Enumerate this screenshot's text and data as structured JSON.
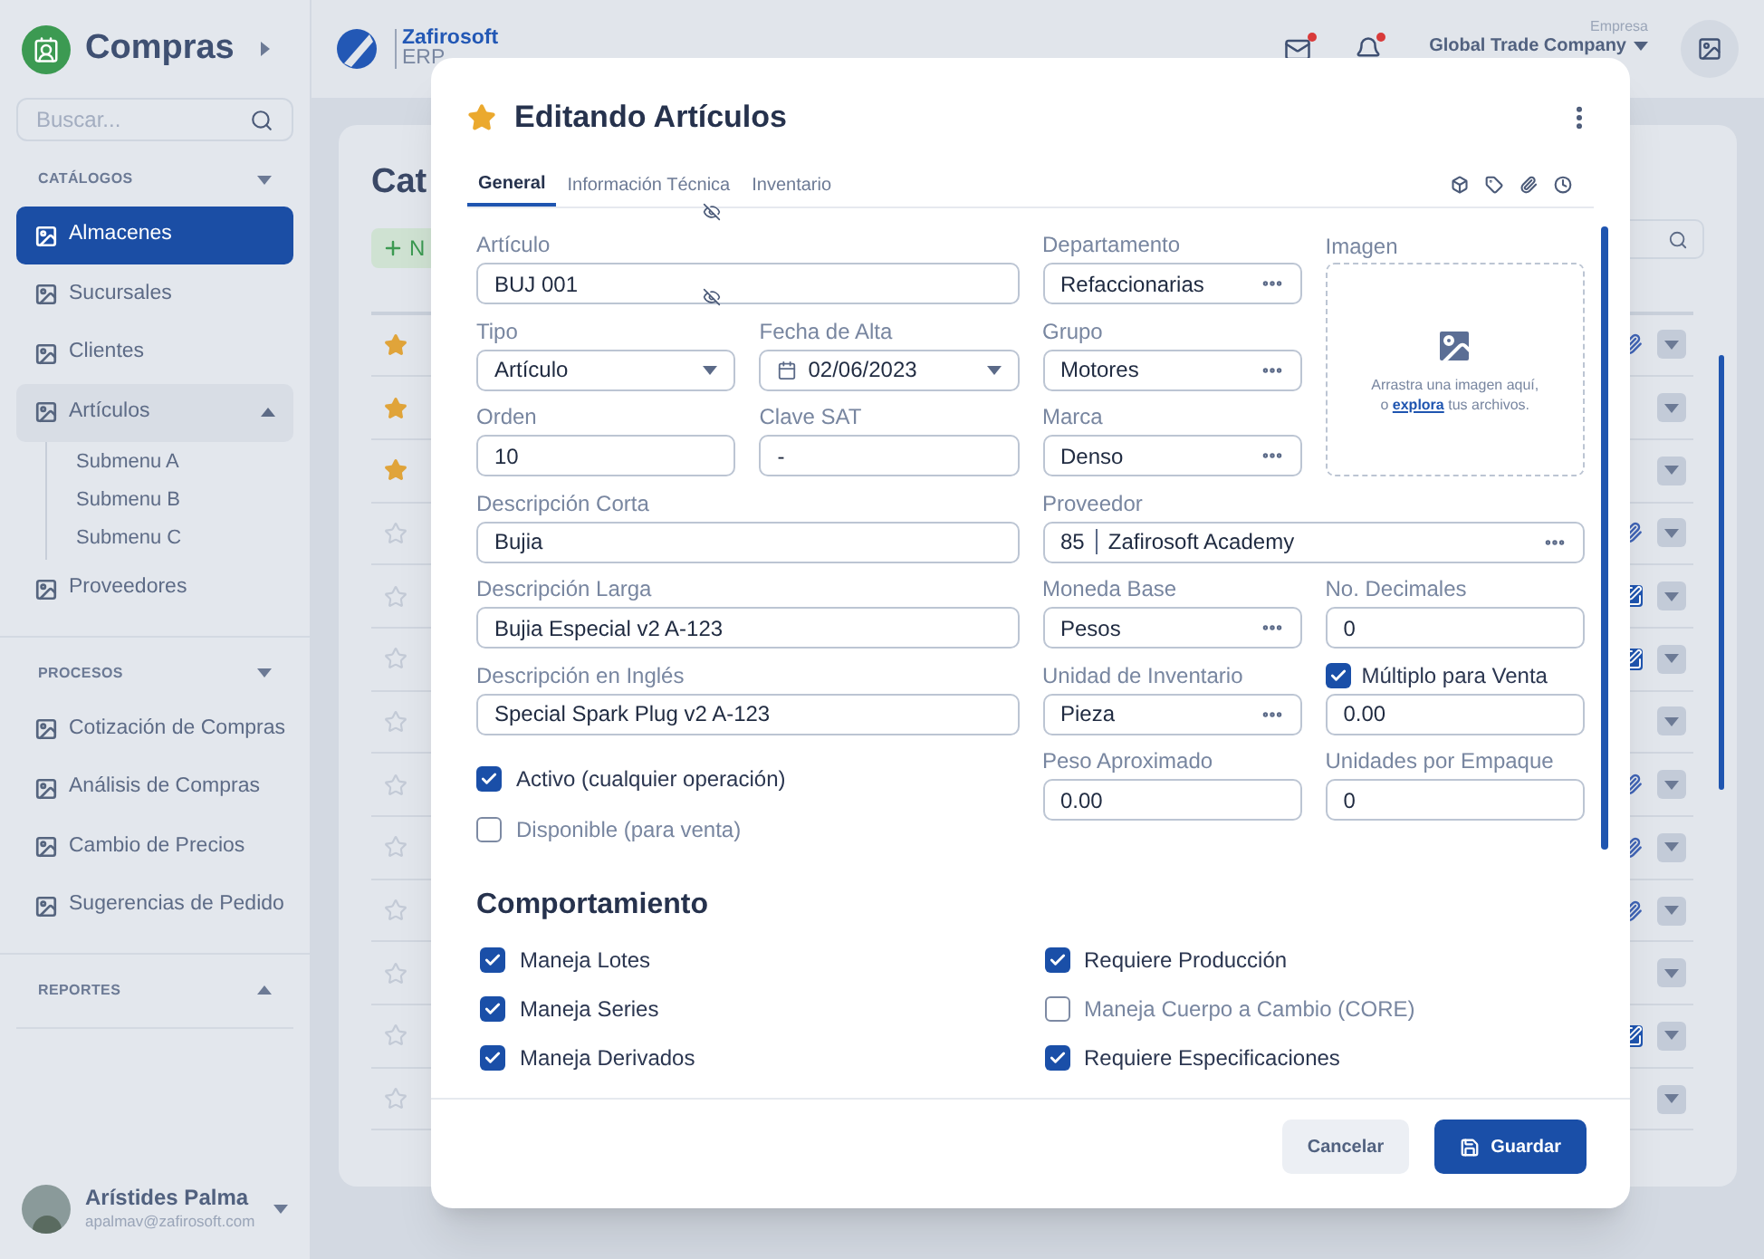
{
  "sidebar": {
    "module_title": "Compras",
    "search": {
      "placeholder": "Buscar..."
    },
    "sections": [
      {
        "title": "CATÁLOGOS",
        "expanded": true,
        "items": [
          {
            "label": "Almacenes",
            "selected": true
          },
          {
            "label": "Sucursales",
            "selected": false
          },
          {
            "label": "Clientes",
            "selected": false
          },
          {
            "label": "Artículos",
            "selected": false,
            "expanded": true,
            "children": [
              {
                "label": "Submenu A"
              },
              {
                "label": "Submenu B"
              },
              {
                "label": "Submenu C"
              }
            ]
          },
          {
            "label": "Proveedores",
            "selected": false
          }
        ]
      },
      {
        "title": "PROCESOS",
        "expanded": true,
        "items": [
          {
            "label": "Cotización de Compras",
            "selected": false
          },
          {
            "label": "Análisis de Compras",
            "selected": false
          },
          {
            "label": "Cambio de Precios",
            "selected": false
          },
          {
            "label": "Sugerencias de Pedido",
            "selected": false
          }
        ]
      },
      {
        "title": "REPORTES",
        "expanded": false
      }
    ],
    "user": {
      "name": "Arístides Palma",
      "email": "apalmav@zafirosoft.com"
    }
  },
  "header": {
    "logo": {
      "name": "Zafirosoft",
      "product": "ERP"
    },
    "mail_unread": true,
    "notifications_unread": true,
    "company_label": "Empresa",
    "company": "Global Trade Company"
  },
  "catalog": {
    "title": "Cat",
    "new_button": "N",
    "rows": [
      {
        "favorite": true,
        "kind": "attachment"
      },
      {
        "favorite": true,
        "kind": "none"
      },
      {
        "favorite": true,
        "kind": "none"
      },
      {
        "favorite": false,
        "kind": "attachment"
      },
      {
        "favorite": false,
        "kind": "edit"
      },
      {
        "favorite": false,
        "kind": "edit"
      },
      {
        "favorite": false,
        "kind": "none"
      },
      {
        "favorite": false,
        "kind": "attachment"
      },
      {
        "favorite": false,
        "kind": "attachment"
      },
      {
        "favorite": false,
        "kind": "attachment"
      },
      {
        "favorite": false,
        "kind": "none"
      },
      {
        "favorite": false,
        "kind": "edit"
      },
      {
        "favorite": false,
        "kind": "none"
      }
    ]
  },
  "modal": {
    "title": "Editando Artículos",
    "favorite": true,
    "tabs": [
      {
        "label": "General",
        "selected": true
      },
      {
        "label": "Información Técnica",
        "selected": false
      },
      {
        "label": "Inventario",
        "selected": false
      }
    ],
    "left_rows": [
      [
        {
          "label": "Artículo",
          "value": "BUJ 001",
          "kind": "text"
        }
      ],
      [
        {
          "label": "Tipo",
          "value": "Artículo",
          "kind": "select"
        },
        {
          "label": "Fecha de Alta",
          "value": "02/06/2023",
          "kind": "date"
        }
      ],
      [
        {
          "label": "Orden",
          "value": "10",
          "kind": "text"
        },
        {
          "label": "Clave SAT",
          "value": "-",
          "kind": "text"
        }
      ],
      [
        {
          "label": "Descripción Corta",
          "value": "Bujia",
          "kind": "text"
        }
      ],
      [
        {
          "label": "Descripción Larga",
          "value": "Bujia Especial v2 A-123",
          "kind": "text"
        }
      ],
      [
        {
          "label": "Descripción en Inglés",
          "value": "Special Spark Plug v2 A-123",
          "kind": "text"
        }
      ]
    ],
    "flags": [
      {
        "label": "Activo (cualquier operación)",
        "checked": true
      },
      {
        "label": "Disponible (para venta)",
        "checked": false
      }
    ],
    "right_top": [
      {
        "label": "Departamento",
        "value": "Refaccionarias",
        "kind": "lookup"
      },
      {
        "label": "Grupo",
        "value": "Motores",
        "kind": "lookup"
      },
      {
        "label": "Marca",
        "value": "Denso",
        "kind": "lookup"
      }
    ],
    "image": {
      "label": "Imagen",
      "hint": "Arrastra una imagen aquí,",
      "hint_prefix": "o",
      "link": "explora",
      "hint_suffix": "tus archivos."
    },
    "right_rows": [
      [
        {
          "label": "Proveedor",
          "code": "85",
          "value": "Zafirosoft Academy",
          "kind": "lookup"
        }
      ],
      [
        {
          "label": "Moneda Base",
          "value": "Pesos",
          "kind": "lookup"
        },
        {
          "label": "No. Decimales",
          "value": "0",
          "kind": "text"
        }
      ],
      [
        {
          "label": "Unidad de Inventario",
          "value": "Pieza",
          "kind": "lookup"
        },
        {
          "label": "Múltiplo para Venta",
          "checked": true,
          "value": "0.00",
          "kind": "text"
        }
      ],
      [
        {
          "label": "Peso Aproximado",
          "value": "0.00",
          "kind": "text"
        },
        {
          "label": "Unidades por Empaque",
          "value": "0",
          "kind": "text"
        }
      ]
    ],
    "behavior": {
      "title": "Comportamiento",
      "options": [
        {
          "label": "Maneja Lotes",
          "checked": true
        },
        {
          "label": "Requiere Producción",
          "checked": true
        },
        {
          "label": "Maneja Series",
          "checked": true
        },
        {
          "label": "Maneja Cuerpo a Cambio (CORE)",
          "checked": false
        },
        {
          "label": "Maneja Derivados",
          "checked": true
        },
        {
          "label": "Requiere Especificaciones",
          "checked": true
        }
      ]
    },
    "buttons": [
      {
        "label": "Cancelar",
        "kind": "secondary"
      },
      {
        "label": "Guardar",
        "kind": "primary"
      }
    ]
  }
}
